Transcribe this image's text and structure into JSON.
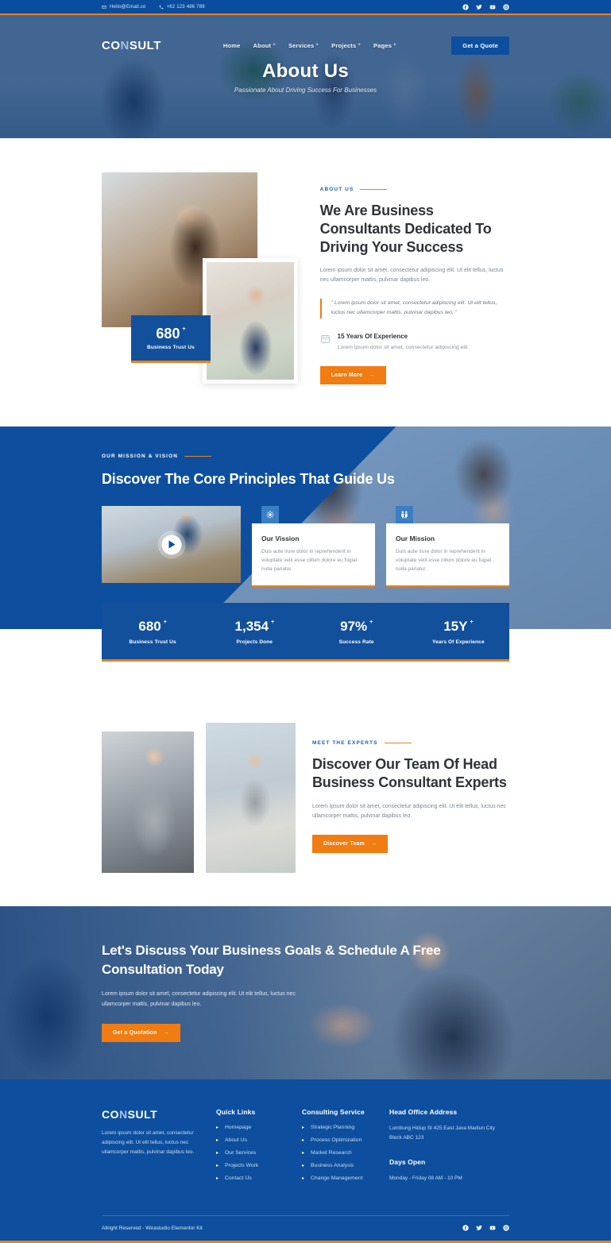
{
  "topbar": {
    "email": "Hello@Email.co",
    "phone": "+62 123 486 789",
    "socials": [
      "facebook-icon",
      "twitter-icon",
      "youtube-icon",
      "pinterest-icon"
    ]
  },
  "nav": {
    "logo_prefix": "CO",
    "logo_mark": "N",
    "logo_suffix": "SULT",
    "items": [
      {
        "label": "Home",
        "has_dropdown": false
      },
      {
        "label": "About",
        "has_dropdown": true
      },
      {
        "label": "Services",
        "has_dropdown": true
      },
      {
        "label": "Projects",
        "has_dropdown": true
      },
      {
        "label": "Pages",
        "has_dropdown": true
      }
    ],
    "cta_label": "Get a Quote"
  },
  "hero": {
    "title": "About Us",
    "subtitle": "Passionate About Driving Success For Businesses"
  },
  "about": {
    "eyebrow": "ABOUT US",
    "heading": "We Are Business Consultants Dedicated To Driving Your Success",
    "paragraph": "Lorem ipsum dolor sit amet, consectetur adipiscing elit. Ut elit tellus, luctus nec ullamcorper mattis, pulvinar dapibus leo.",
    "quote": "\" Lorem ipsum dolor sit amet, consectetur adipiscing elit. Ut elit tellus, luctus nec ullamcorper mattis, pulvinar dapibus leo. \"",
    "feature_title": "15 Years Of Experience",
    "feature_desc": "Lorem ipsum dolor sit amet, consectetur adipiscing elit.",
    "button_label": "Learn More",
    "badge": {
      "number": "680",
      "suffix": "+",
      "label": "Business Trust Us"
    }
  },
  "mission": {
    "eyebrow": "OUR MISSION & VISION",
    "heading": "Discover The Core Principles That Guide Us",
    "cards": [
      {
        "icon": "vision-eye-icon",
        "title": "Our Vission",
        "desc": "Duis aute irure dolor in reprehenderit in voluptate velit esse cillum dolore eu fugiat nulla pariatur."
      },
      {
        "icon": "people-group-icon",
        "title": "Our Mission",
        "desc": "Duis aute irure dolor in reprehenderit in voluptate velit esse cillum dolore eu fugiat nulla pariatur."
      }
    ]
  },
  "stats": [
    {
      "value": "680",
      "suffix": "+",
      "label": "Business Trust Us"
    },
    {
      "value": "1,354",
      "suffix": "+",
      "label": "Projects Done"
    },
    {
      "value": "97%",
      "suffix": "+",
      "label": "Success Rate"
    },
    {
      "value": "15Y",
      "suffix": "+",
      "label": "Years Of Experience"
    }
  ],
  "team": {
    "eyebrow": "MEET THE EXPERTS",
    "heading": "Discover Our Team Of Head Business Consultant Experts",
    "paragraph": "Lorem ipsum dolor sit amet, consectetur adipiscing elit. Ut elit tellus, luctus nec ullamcorper mattis, pulvinar dapibus leo.",
    "button_label": "Discover Team"
  },
  "cta": {
    "heading": "Let's Discuss Your Business Goals & Schedule A Free Consultation Today",
    "paragraph": "Lorem ipsum dolor sit amet, consectetur adipiscing elit. Ut elit tellus, luctus nec ullamcorper mattis, pulvinar dapibus leo.",
    "button_label": "Get a Quotation"
  },
  "footer": {
    "logo_prefix": "CO",
    "logo_mark": "N",
    "logo_suffix": "SULT",
    "description": "Lorem ipsum dolor sit amet, consectetur adipiscing elit. Ut elit tellus, luctus nec ullamcorper mattis, pulvinar dapibus leo.",
    "quick_links_head": "Quick Links",
    "quick_links": [
      "Homepage",
      "About Us",
      "Our Services",
      "Projects Work",
      "Contact Us"
    ],
    "service_head": "Consulting Service",
    "services": [
      "Strategic Planning",
      "Process Optimization",
      "Market Research",
      "Business Analysis",
      "Change Management"
    ],
    "address_head": "Head Office Address",
    "address": "Lumbung Hidup St 425 East Java Madiun City Block ABC 123",
    "days_head": "Days Open",
    "days": "Monday - Friday 08 AM - 10 PM",
    "copyright": "Allright Reserved - Wirastudio Elementor Kit",
    "socials": [
      "facebook-icon",
      "twitter-icon",
      "youtube-icon",
      "pinterest-icon"
    ]
  },
  "colors": {
    "brand_blue": "#0d4f9e",
    "deep_blue": "#12509c",
    "accent_orange": "#e8821a",
    "button_orange": "#f07c12",
    "heading_dark": "#2f3338"
  }
}
